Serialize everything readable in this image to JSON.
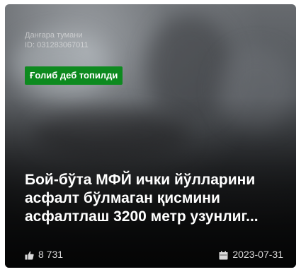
{
  "card": {
    "district": "Данғара тумани",
    "id_text": "ID: 031283067011",
    "status_badge": "Ғолиб деб топилди",
    "title": "Бой-бўта МФЙ ички йўлларини асфалт бўлмаган қисмини асфалтлаш 3200 метр узунлиг...",
    "likes": "8 731",
    "date": "2023-07-31",
    "icons": {
      "likes": "thumbs-up-icon",
      "date": "calendar-icon"
    },
    "colors": {
      "badge": "#0d8a1f",
      "title": "#ffffff"
    }
  }
}
